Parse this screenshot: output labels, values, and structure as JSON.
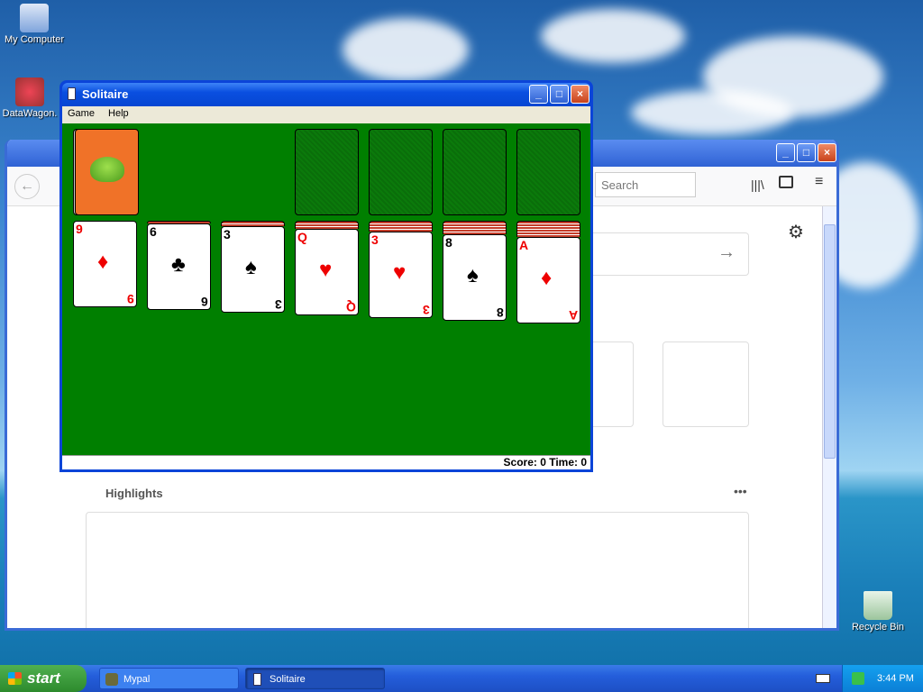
{
  "desktop": {
    "icons": [
      {
        "label": "My Computer",
        "icon": "my-computer-icon"
      },
      {
        "label": "DataWagon.",
        "icon": "datawagon-shortcut-icon"
      },
      {
        "label": "Recycle Bin",
        "icon": "recycle-bin-icon"
      }
    ]
  },
  "browser": {
    "search_placeholder": "Search",
    "section_title": "Highlights",
    "more_menu": "•••"
  },
  "solitaire": {
    "title": "Solitaire",
    "menu": [
      "Game",
      "Help"
    ],
    "status": "Score: 0 Time: 0",
    "tableau": [
      {
        "rank": "9",
        "suit": "♦",
        "color": "red"
      },
      {
        "rank": "6",
        "suit": "♣",
        "color": "black"
      },
      {
        "rank": "3",
        "suit": "♠",
        "color": "black"
      },
      {
        "rank": "Q",
        "suit": "♥",
        "color": "red"
      },
      {
        "rank": "3",
        "suit": "♥",
        "color": "red"
      },
      {
        "rank": "8",
        "suit": "♠",
        "color": "black"
      },
      {
        "rank": "A",
        "suit": "♦",
        "color": "red"
      }
    ]
  },
  "taskbar": {
    "start_label": "start",
    "tasks": [
      "Mypal",
      "Solitaire"
    ],
    "clock": "3:44 PM"
  }
}
